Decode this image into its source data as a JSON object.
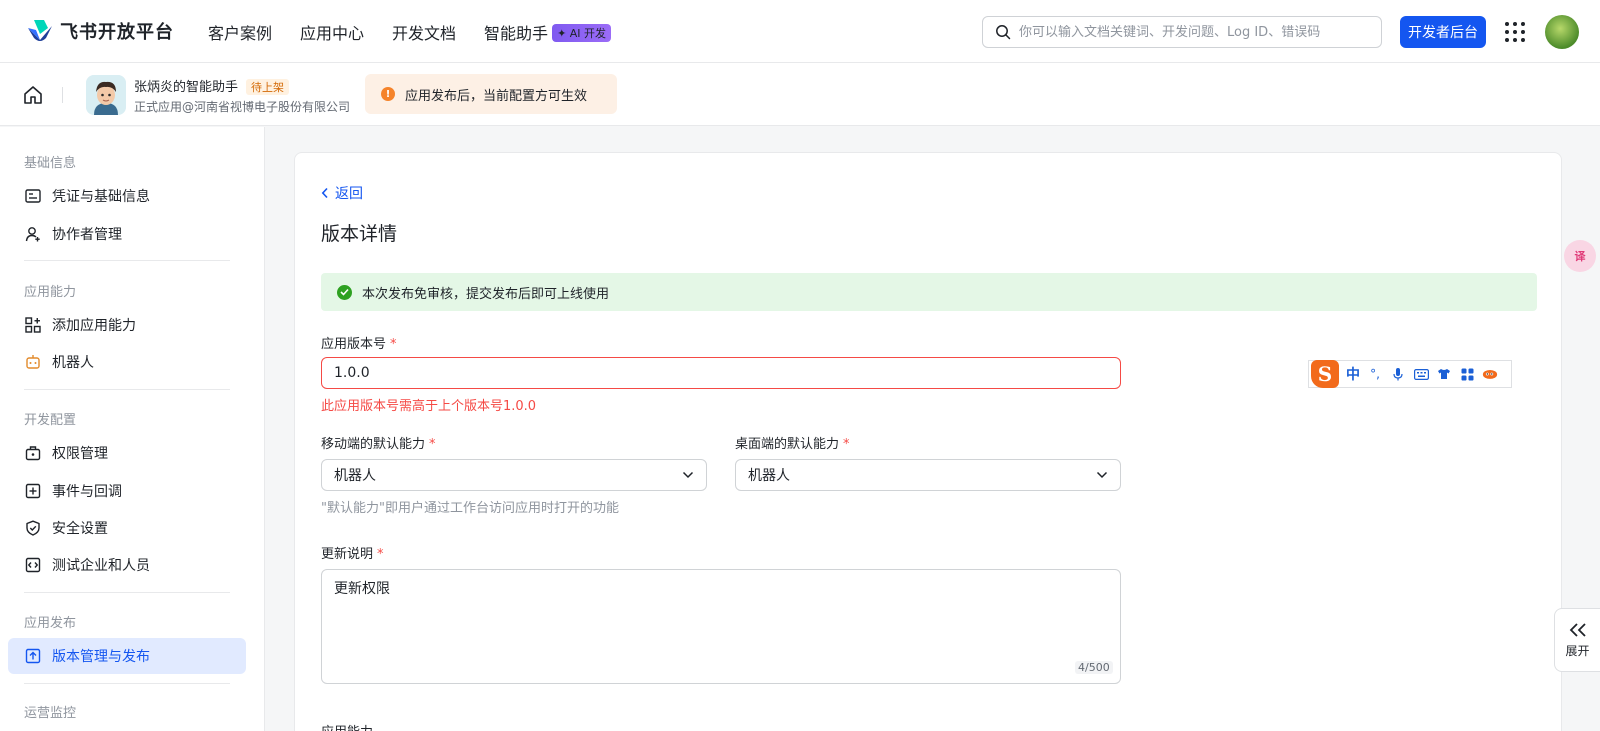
{
  "header": {
    "logo_text": "飞书开放平台",
    "nav": [
      "客户案例",
      "应用中心",
      "开发文档",
      "智能助手"
    ],
    "ai_badge": "✦ AI 开发",
    "search_placeholder": "你可以输入文档关键词、开发问题、Log ID、错误码",
    "dev_console_button": "开发者后台"
  },
  "subheader": {
    "app_name": "张炳炎的智能助手",
    "status_badge": "待上架",
    "app_org": "正式应用@河南省视博电子股份有限公司",
    "notice": "应用发布后，当前配置方可生效",
    "notice_icon": "!"
  },
  "sidebar": {
    "groups": [
      {
        "title": "基础信息",
        "items": [
          "凭证与基础信息",
          "协作者管理"
        ]
      },
      {
        "title": "应用能力",
        "items": [
          "添加应用能力",
          "机器人"
        ]
      },
      {
        "title": "开发配置",
        "items": [
          "权限管理",
          "事件与回调",
          "安全设置",
          "测试企业和人员"
        ]
      },
      {
        "title": "应用发布",
        "items": [
          "版本管理与发布"
        ]
      },
      {
        "title": "运营监控",
        "items": []
      }
    ],
    "active_item": "版本管理与发布",
    "accent_color": "#1456f0"
  },
  "main": {
    "back_label": "返回",
    "title": "版本详情",
    "success_message": "本次发布免审核，提交发布后即可上线使用",
    "version_label": "应用版本号",
    "required_mark": "*",
    "version_value": "1.0.0",
    "version_error": "此应用版本号需高于上个版本号1.0.0",
    "mobile_default_label": "移动端的默认能力",
    "mobile_default_value": "机器人",
    "desktop_default_label": "桌面端的默认能力",
    "desktop_default_value": "机器人",
    "default_hint": "\"默认能力\"即用户通过工作台访问应用时打开的功能",
    "update_notes_label": "更新说明",
    "update_notes_value": "更新权限",
    "update_notes_counter": "4/500",
    "capabilities_label": "应用能力"
  },
  "ime": {
    "logo": "S",
    "mode": "中",
    "punct": "°,"
  },
  "floating": {
    "translate_label": "译",
    "expand_label": "展开"
  }
}
